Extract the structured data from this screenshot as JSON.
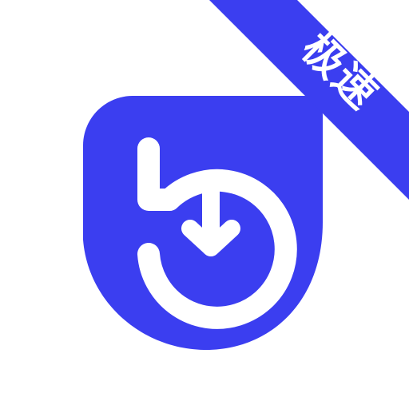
{
  "badge": {
    "label": "极速"
  },
  "icon": {
    "name": "download-refresh-icon"
  },
  "colors": {
    "brand": "#3b3ef0",
    "foreground": "#ffffff",
    "background": "#ffffff"
  }
}
